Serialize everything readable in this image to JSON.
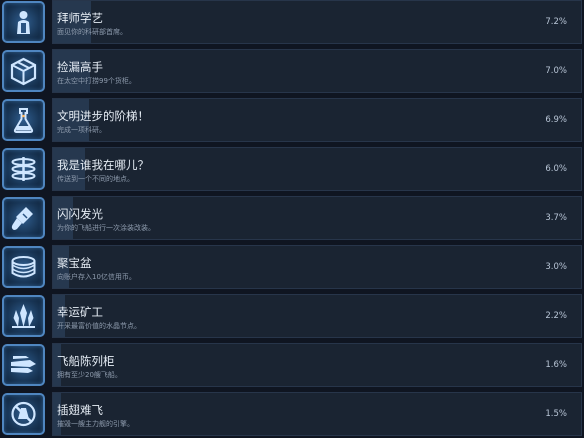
{
  "achievements": [
    {
      "title": "拜师学艺",
      "description": "面见你的科研部首席。",
      "percent_label": "7.2%",
      "percent": 7.2,
      "icon": "scholar-icon"
    },
    {
      "title": "捡漏高手",
      "description": "在太空中打捞99个货柜。",
      "percent_label": "7.0%",
      "percent": 7.0,
      "icon": "crate-icon"
    },
    {
      "title": "文明进步的阶梯！",
      "description": "完成一项科研。",
      "percent_label": "6.9%",
      "percent": 6.9,
      "icon": "flask-icon"
    },
    {
      "title": "我是谁我在哪儿？",
      "description": "传送到一个不同的地点。",
      "percent_label": "6.0%",
      "percent": 6.0,
      "icon": "teleport-icon"
    },
    {
      "title": "闪闪发光",
      "description": "为你的飞船进行一次涂装改装。",
      "percent_label": "3.7%",
      "percent": 3.7,
      "icon": "paint-brush-icon"
    },
    {
      "title": "聚宝盆",
      "description": "向账户存入10亿信用币。",
      "percent_label": "3.0%",
      "percent": 3.0,
      "icon": "coins-icon"
    },
    {
      "title": "幸运矿工",
      "description": "开采最富价值的水晶节点。",
      "percent_label": "2.2%",
      "percent": 2.2,
      "icon": "crystal-icon"
    },
    {
      "title": "飞船陈列柜",
      "description": "拥有至少20艘飞船。",
      "percent_label": "1.6%",
      "percent": 1.6,
      "icon": "ship-icon"
    },
    {
      "title": "插翅难飞",
      "description": "摧毁一艘主力舰的引擎。",
      "percent_label": "1.5%",
      "percent": 1.5,
      "icon": "broken-engine-icon"
    }
  ]
}
